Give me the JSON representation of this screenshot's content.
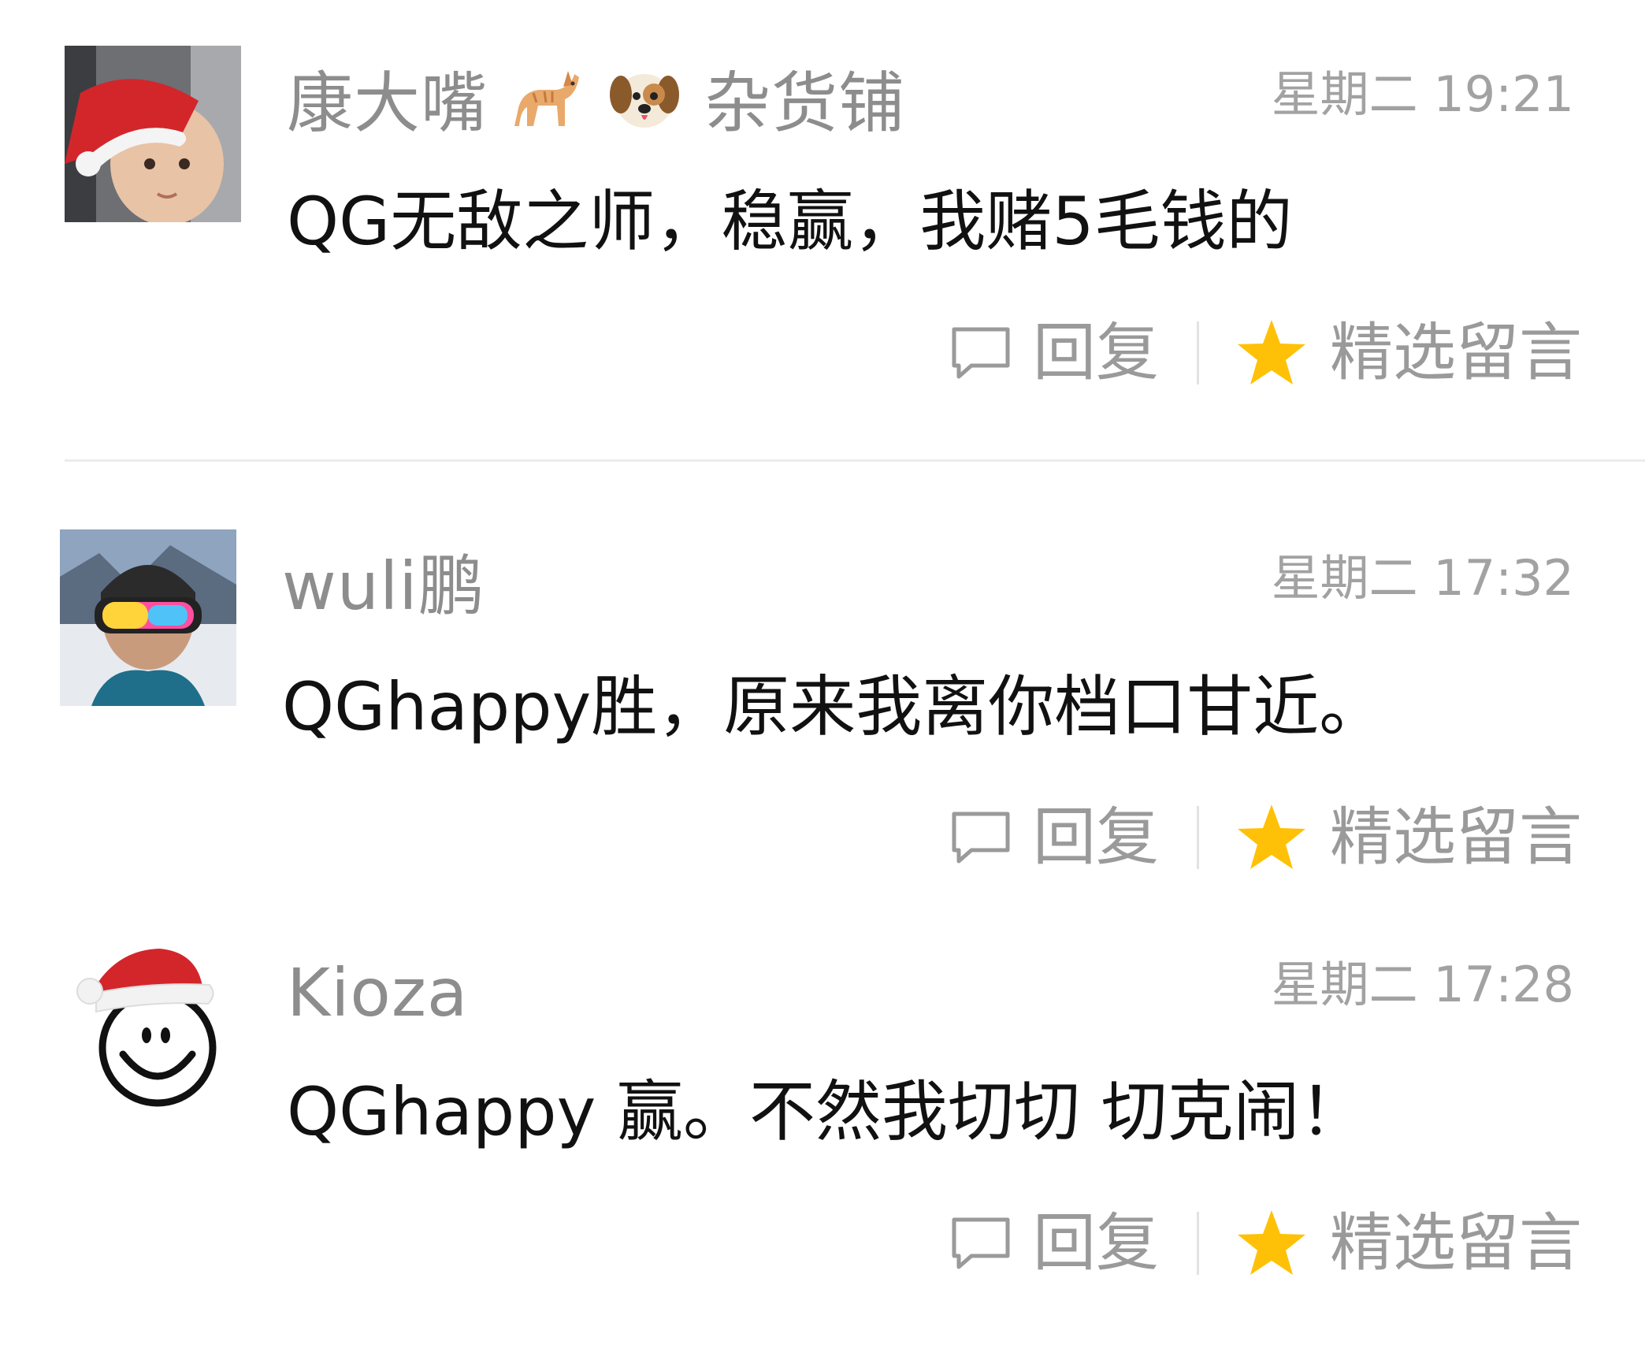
{
  "comments": [
    {
      "nickname": "康大嘴",
      "nickname_suffix": "杂货铺",
      "nickname_emojis": [
        "cat-emoji",
        "dog-face-emoji"
      ],
      "time": "星期二 19:21",
      "content": "QG无敌之师，稳赢，我赌5毛钱的",
      "avatar": "baby-santa-hat-avatar"
    },
    {
      "nickname": "wuli鹏",
      "time": "星期二 17:32",
      "content": "QGhappy胜，原来我离你档口甘近。",
      "avatar": "skier-goggles-avatar"
    },
    {
      "nickname": "Kioza",
      "time": "星期二 17:28",
      "content": "QGhappy 赢。不然我切切 切克闹！",
      "avatar": "smiley-santa-hat-avatar"
    }
  ],
  "actions": {
    "reply_label": "回复",
    "feature_label": "精选留言"
  },
  "colors": {
    "star": "#ffc107",
    "meta_text": "#9a9a9a"
  }
}
